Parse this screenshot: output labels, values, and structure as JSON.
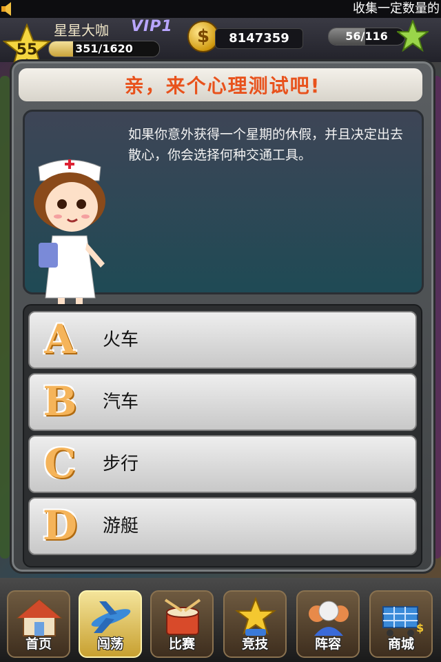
{
  "ticker": {
    "text": "收集一定数量的"
  },
  "status": {
    "level": "55",
    "player_name": "星星大咖",
    "vip": "VIP1",
    "xp_text": "351/1620",
    "xp_fraction": 0.217,
    "coins": "8147359",
    "energy_text": "56/116",
    "energy_fraction": 0.483
  },
  "dialog": {
    "title": "亲，来个心理测试吧!",
    "question": "如果你意外获得一个星期的休假，并且决定出去散心，你会选择何种交通工具。",
    "options": [
      {
        "letter": "A",
        "text": "火车"
      },
      {
        "letter": "B",
        "text": "汽车"
      },
      {
        "letter": "C",
        "text": "步行"
      },
      {
        "letter": "D",
        "text": "游艇"
      }
    ]
  },
  "nav": {
    "items": [
      {
        "label": "首页",
        "icon": "house-icon",
        "active": false
      },
      {
        "label": "闯荡",
        "icon": "airplane-icon",
        "active": true
      },
      {
        "label": "比赛",
        "icon": "drum-icon",
        "active": false
      },
      {
        "label": "竞技",
        "icon": "trophy-star-icon",
        "active": false
      },
      {
        "label": "阵容",
        "icon": "team-icon",
        "active": false
      },
      {
        "label": "商城",
        "icon": "shopping-cart-icon",
        "active": false
      }
    ]
  },
  "colors": {
    "title": "#e8521c",
    "option_letter": "#f5b45a",
    "vip": "#b9a6ff"
  }
}
